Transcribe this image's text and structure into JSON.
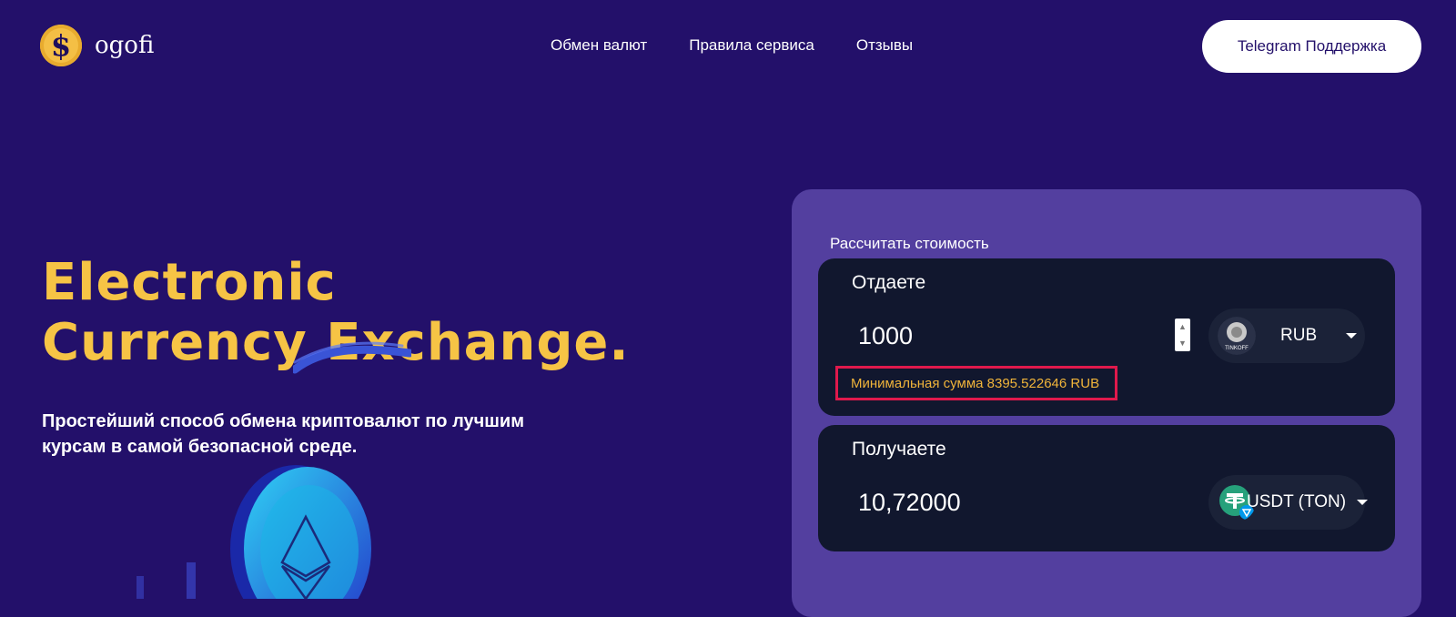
{
  "header": {
    "logo_text": "ogofi",
    "logo_glyph": "$",
    "nav": [
      {
        "label": "Обмен валют"
      },
      {
        "label": "Правила сервиса"
      },
      {
        "label": "Отзывы"
      }
    ],
    "support_button": "Telegram Поддержка"
  },
  "hero": {
    "title_line1": "Electronic",
    "title_line2": "Currency Exchange.",
    "subtitle": "Простейший способ обмена криптовалют по лучшим курсам в самой безопасной среде."
  },
  "exchange": {
    "title": "Рассчитать стоимость",
    "give": {
      "label": "Отдаете",
      "amount": "1000",
      "currency": "RUB",
      "currency_icon": "tinkoff-bank-icon",
      "bank_caption": "TINKOFF",
      "warning": "Минимальная сумма 8395.522646 RUB"
    },
    "get": {
      "label": "Получаете",
      "amount": "10,72000",
      "currency": "USDT (TON)",
      "currency_icon": "tether-ton-icon"
    }
  },
  "colors": {
    "background": "#23106a",
    "accent_yellow": "#f6c445",
    "panel": "#533f9f",
    "box": "#11172e",
    "warning_border": "#e0194c",
    "warning_text": "#f0b43a"
  }
}
